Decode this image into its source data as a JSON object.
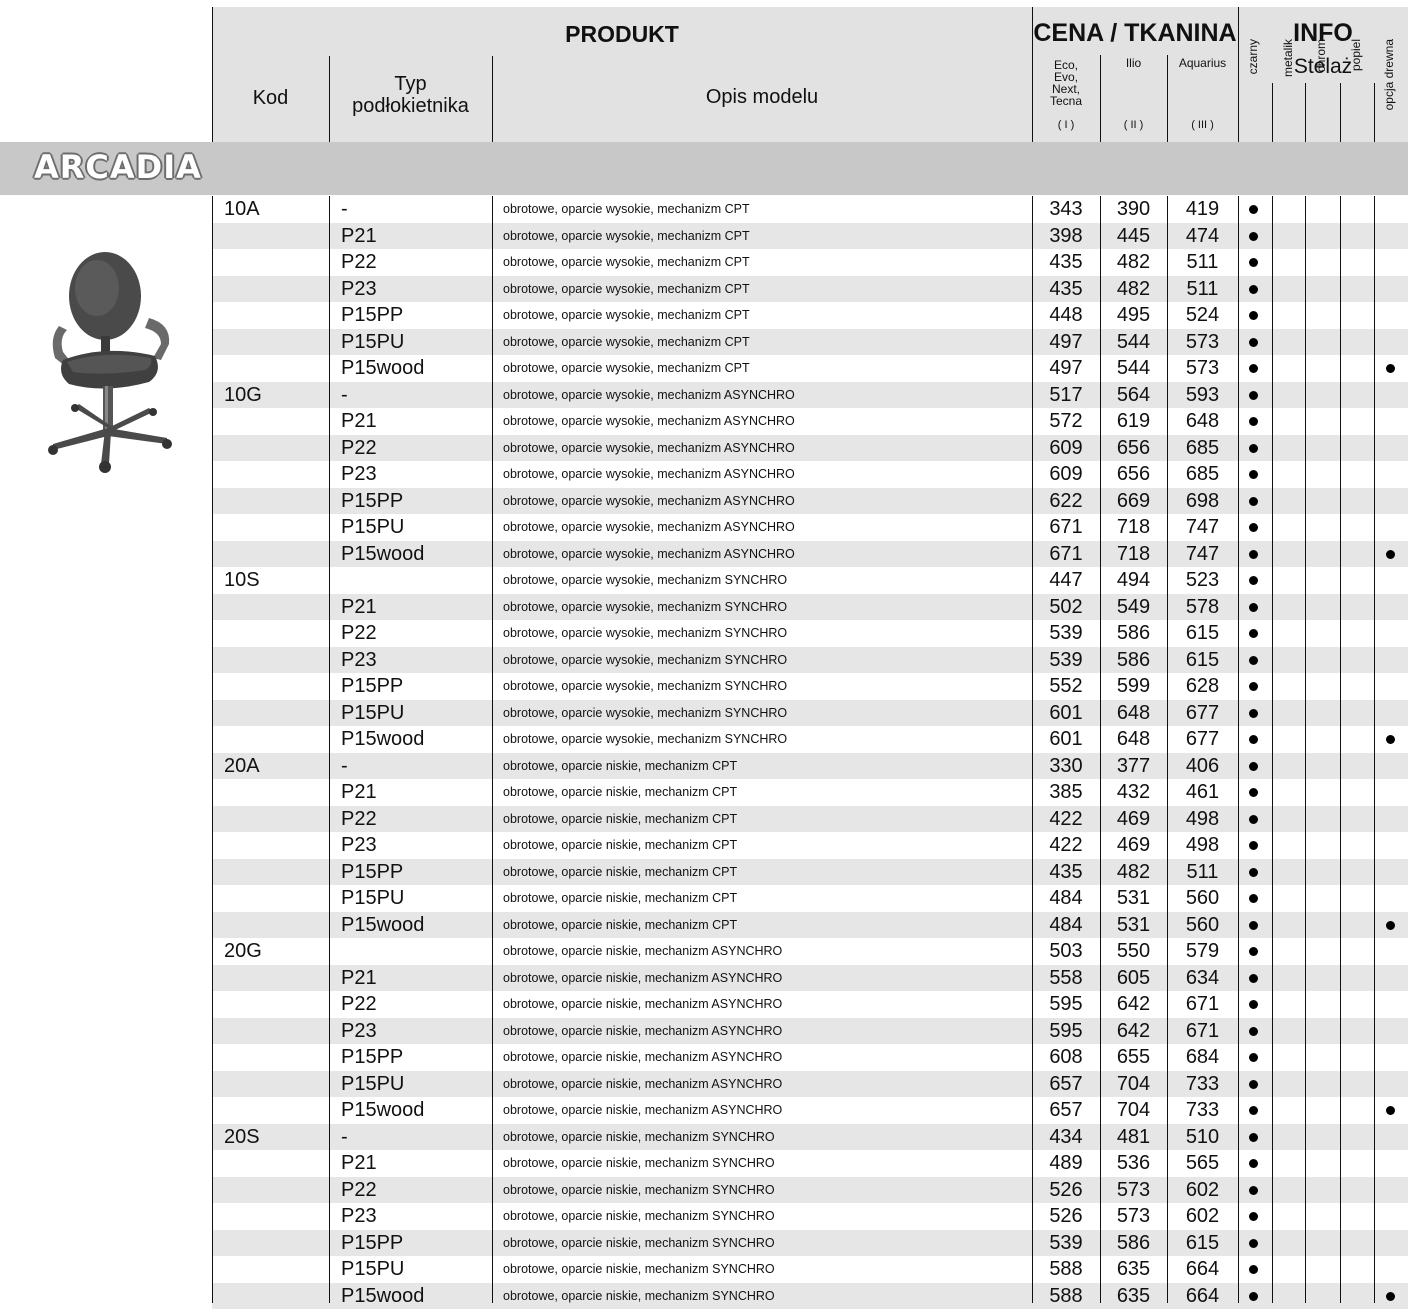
{
  "header": {
    "produkt": "PRODUKT",
    "cena": "CENA / TKANINA",
    "info": "INFO",
    "stelaz": "Stelaż",
    "kod": "Kod",
    "typ_line1": "Typ",
    "typ_line2": "podłokietnika",
    "opis": "Opis modelu",
    "eco_lines": [
      "Eco,",
      "Evo,",
      "Next,",
      "Tecna"
    ],
    "ilio": "Ilio",
    "aquarius": "Aquarius",
    "roman": [
      "( I )",
      "( II )",
      "( III )"
    ],
    "frame_cols": [
      "czarny",
      "metalik",
      "chrom",
      "popiel",
      "opcja drewna"
    ]
  },
  "series": {
    "title": "ARCADIA"
  },
  "rows": [
    {
      "kod": "10A",
      "typ": "-",
      "opis": "obrotowe, oparcie wysokie, mechanizm CPT",
      "p": [
        "343",
        "390",
        "419"
      ],
      "wood": false
    },
    {
      "kod": "",
      "typ": "P21",
      "opis": "obrotowe, oparcie wysokie, mechanizm CPT",
      "p": [
        "398",
        "445",
        "474"
      ],
      "wood": false
    },
    {
      "kod": "",
      "typ": "P22",
      "opis": "obrotowe, oparcie wysokie, mechanizm CPT",
      "p": [
        "435",
        "482",
        "511"
      ],
      "wood": false
    },
    {
      "kod": "",
      "typ": "P23",
      "opis": "obrotowe, oparcie wysokie, mechanizm CPT",
      "p": [
        "435",
        "482",
        "511"
      ],
      "wood": false
    },
    {
      "kod": "",
      "typ": "P15PP",
      "opis": "obrotowe, oparcie wysokie, mechanizm CPT",
      "p": [
        "448",
        "495",
        "524"
      ],
      "wood": false
    },
    {
      "kod": "",
      "typ": "P15PU",
      "opis": "obrotowe, oparcie wysokie, mechanizm CPT",
      "p": [
        "497",
        "544",
        "573"
      ],
      "wood": false
    },
    {
      "kod": "",
      "typ": "P15wood",
      "opis": "obrotowe, oparcie wysokie, mechanizm CPT",
      "p": [
        "497",
        "544",
        "573"
      ],
      "wood": true
    },
    {
      "kod": "10G",
      "typ": "-",
      "opis": "obrotowe, oparcie wysokie, mechanizm ASYNCHRO",
      "p": [
        "517",
        "564",
        "593"
      ],
      "wood": false
    },
    {
      "kod": "",
      "typ": "P21",
      "opis": "obrotowe, oparcie wysokie, mechanizm ASYNCHRO",
      "p": [
        "572",
        "619",
        "648"
      ],
      "wood": false
    },
    {
      "kod": "",
      "typ": "P22",
      "opis": "obrotowe, oparcie wysokie, mechanizm ASYNCHRO",
      "p": [
        "609",
        "656",
        "685"
      ],
      "wood": false
    },
    {
      "kod": "",
      "typ": "P23",
      "opis": "obrotowe, oparcie wysokie, mechanizm ASYNCHRO",
      "p": [
        "609",
        "656",
        "685"
      ],
      "wood": false
    },
    {
      "kod": "",
      "typ": "P15PP",
      "opis": "obrotowe, oparcie wysokie, mechanizm ASYNCHRO",
      "p": [
        "622",
        "669",
        "698"
      ],
      "wood": false
    },
    {
      "kod": "",
      "typ": "P15PU",
      "opis": "obrotowe, oparcie wysokie, mechanizm ASYNCHRO",
      "p": [
        "671",
        "718",
        "747"
      ],
      "wood": false
    },
    {
      "kod": "",
      "typ": "P15wood",
      "opis": "obrotowe, oparcie wysokie, mechanizm ASYNCHRO",
      "p": [
        "671",
        "718",
        "747"
      ],
      "wood": true
    },
    {
      "kod": "10S",
      "typ": "",
      "opis": "obrotowe, oparcie wysokie, mechanizm SYNCHRO",
      "p": [
        "447",
        "494",
        "523"
      ],
      "wood": false
    },
    {
      "kod": "",
      "typ": "P21",
      "opis": "obrotowe, oparcie wysokie, mechanizm SYNCHRO",
      "p": [
        "502",
        "549",
        "578"
      ],
      "wood": false
    },
    {
      "kod": "",
      "typ": "P22",
      "opis": "obrotowe, oparcie wysokie, mechanizm SYNCHRO",
      "p": [
        "539",
        "586",
        "615"
      ],
      "wood": false
    },
    {
      "kod": "",
      "typ": "P23",
      "opis": "obrotowe, oparcie wysokie, mechanizm SYNCHRO",
      "p": [
        "539",
        "586",
        "615"
      ],
      "wood": false
    },
    {
      "kod": "",
      "typ": "P15PP",
      "opis": "obrotowe, oparcie wysokie, mechanizm SYNCHRO",
      "p": [
        "552",
        "599",
        "628"
      ],
      "wood": false
    },
    {
      "kod": "",
      "typ": "P15PU",
      "opis": "obrotowe, oparcie wysokie, mechanizm SYNCHRO",
      "p": [
        "601",
        "648",
        "677"
      ],
      "wood": false
    },
    {
      "kod": "",
      "typ": "P15wood",
      "opis": "obrotowe, oparcie wysokie, mechanizm SYNCHRO",
      "p": [
        "601",
        "648",
        "677"
      ],
      "wood": true
    },
    {
      "kod": "20A",
      "typ": "-",
      "opis": "obrotowe, oparcie niskie, mechanizm CPT",
      "p": [
        "330",
        "377",
        "406"
      ],
      "wood": false
    },
    {
      "kod": "",
      "typ": "P21",
      "opis": "obrotowe, oparcie niskie, mechanizm CPT",
      "p": [
        "385",
        "432",
        "461"
      ],
      "wood": false
    },
    {
      "kod": "",
      "typ": "P22",
      "opis": "obrotowe, oparcie niskie, mechanizm CPT",
      "p": [
        "422",
        "469",
        "498"
      ],
      "wood": false
    },
    {
      "kod": "",
      "typ": "P23",
      "opis": "obrotowe, oparcie niskie, mechanizm CPT",
      "p": [
        "422",
        "469",
        "498"
      ],
      "wood": false
    },
    {
      "kod": "",
      "typ": "P15PP",
      "opis": "obrotowe, oparcie niskie, mechanizm CPT",
      "p": [
        "435",
        "482",
        "511"
      ],
      "wood": false
    },
    {
      "kod": "",
      "typ": "P15PU",
      "opis": "obrotowe, oparcie niskie, mechanizm CPT",
      "p": [
        "484",
        "531",
        "560"
      ],
      "wood": false
    },
    {
      "kod": "",
      "typ": "P15wood",
      "opis": "obrotowe, oparcie niskie, mechanizm CPT",
      "p": [
        "484",
        "531",
        "560"
      ],
      "wood": true
    },
    {
      "kod": "20G",
      "typ": "",
      "opis": "obrotowe, oparcie niskie, mechanizm ASYNCHRO",
      "p": [
        "503",
        "550",
        "579"
      ],
      "wood": false
    },
    {
      "kod": "",
      "typ": "P21",
      "opis": "obrotowe, oparcie niskie, mechanizm ASYNCHRO",
      "p": [
        "558",
        "605",
        "634"
      ],
      "wood": false
    },
    {
      "kod": "",
      "typ": "P22",
      "opis": "obrotowe, oparcie niskie, mechanizm ASYNCHRO",
      "p": [
        "595",
        "642",
        "671"
      ],
      "wood": false
    },
    {
      "kod": "",
      "typ": "P23",
      "opis": "obrotowe, oparcie niskie, mechanizm ASYNCHRO",
      "p": [
        "595",
        "642",
        "671"
      ],
      "wood": false
    },
    {
      "kod": "",
      "typ": "P15PP",
      "opis": "obrotowe, oparcie niskie, mechanizm ASYNCHRO",
      "p": [
        "608",
        "655",
        "684"
      ],
      "wood": false
    },
    {
      "kod": "",
      "typ": "P15PU",
      "opis": "obrotowe, oparcie niskie, mechanizm ASYNCHRO",
      "p": [
        "657",
        "704",
        "733"
      ],
      "wood": false
    },
    {
      "kod": "",
      "typ": "P15wood",
      "opis": "obrotowe, oparcie niskie, mechanizm ASYNCHRO",
      "p": [
        "657",
        "704",
        "733"
      ],
      "wood": true
    },
    {
      "kod": "20S",
      "typ": "-",
      "opis": "obrotowe, oparcie niskie, mechanizm SYNCHRO",
      "p": [
        "434",
        "481",
        "510"
      ],
      "wood": false
    },
    {
      "kod": "",
      "typ": "P21",
      "opis": "obrotowe, oparcie niskie, mechanizm SYNCHRO",
      "p": [
        "489",
        "536",
        "565"
      ],
      "wood": false
    },
    {
      "kod": "",
      "typ": "P22",
      "opis": "obrotowe, oparcie niskie, mechanizm SYNCHRO",
      "p": [
        "526",
        "573",
        "602"
      ],
      "wood": false
    },
    {
      "kod": "",
      "typ": "P23",
      "opis": "obrotowe, oparcie niskie, mechanizm SYNCHRO",
      "p": [
        "526",
        "573",
        "602"
      ],
      "wood": false
    },
    {
      "kod": "",
      "typ": "P15PP",
      "opis": "obrotowe, oparcie niskie, mechanizm SYNCHRO",
      "p": [
        "539",
        "586",
        "615"
      ],
      "wood": false
    },
    {
      "kod": "",
      "typ": "P15PU",
      "opis": "obrotowe, oparcie niskie, mechanizm SYNCHRO",
      "p": [
        "588",
        "635",
        "664"
      ],
      "wood": false
    },
    {
      "kod": "",
      "typ": "P15wood",
      "opis": "obrotowe, oparcie niskie, mechanizm SYNCHRO",
      "p": [
        "588",
        "635",
        "664"
      ],
      "wood": true
    }
  ],
  "colors": {
    "header_bg": "#e2e2e2",
    "band_bg": "#c8c8c8",
    "row_shade": "#e6e6e6",
    "title_outline": "#6d6d6d"
  }
}
